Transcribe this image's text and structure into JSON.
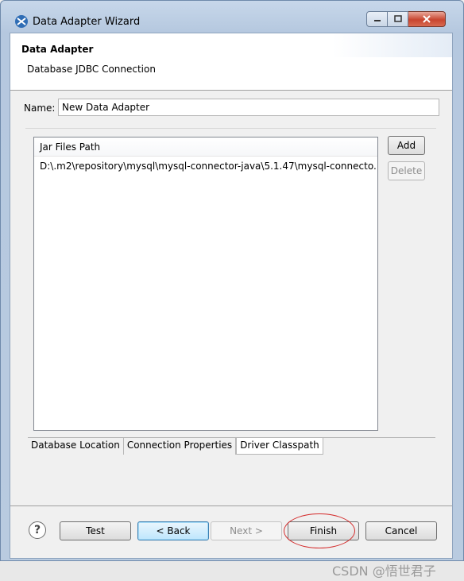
{
  "window": {
    "title": "Data Adapter Wizard",
    "icon": "eclipse-icon"
  },
  "header": {
    "title": "Data Adapter",
    "description": "Database JDBC Connection"
  },
  "name_field": {
    "label": "Name:",
    "value": "New Data Adapter"
  },
  "jar_table": {
    "column_header": "Jar Files Path",
    "rows": [
      "D:\\.m2\\repository\\mysql\\mysql-connector-java\\5.1.47\\mysql-connecto..."
    ]
  },
  "side_buttons": {
    "add": "Add",
    "delete": "Delete"
  },
  "tabs": [
    {
      "label": "Database Location"
    },
    {
      "label": "Connection Properties"
    },
    {
      "label": "Driver Classpath",
      "selected": true
    }
  ],
  "footer": {
    "help": "?",
    "test": "Test",
    "back": "< Back",
    "next": "Next >",
    "finish": "Finish",
    "cancel": "Cancel"
  },
  "watermark": "CSDN @悟世君子"
}
